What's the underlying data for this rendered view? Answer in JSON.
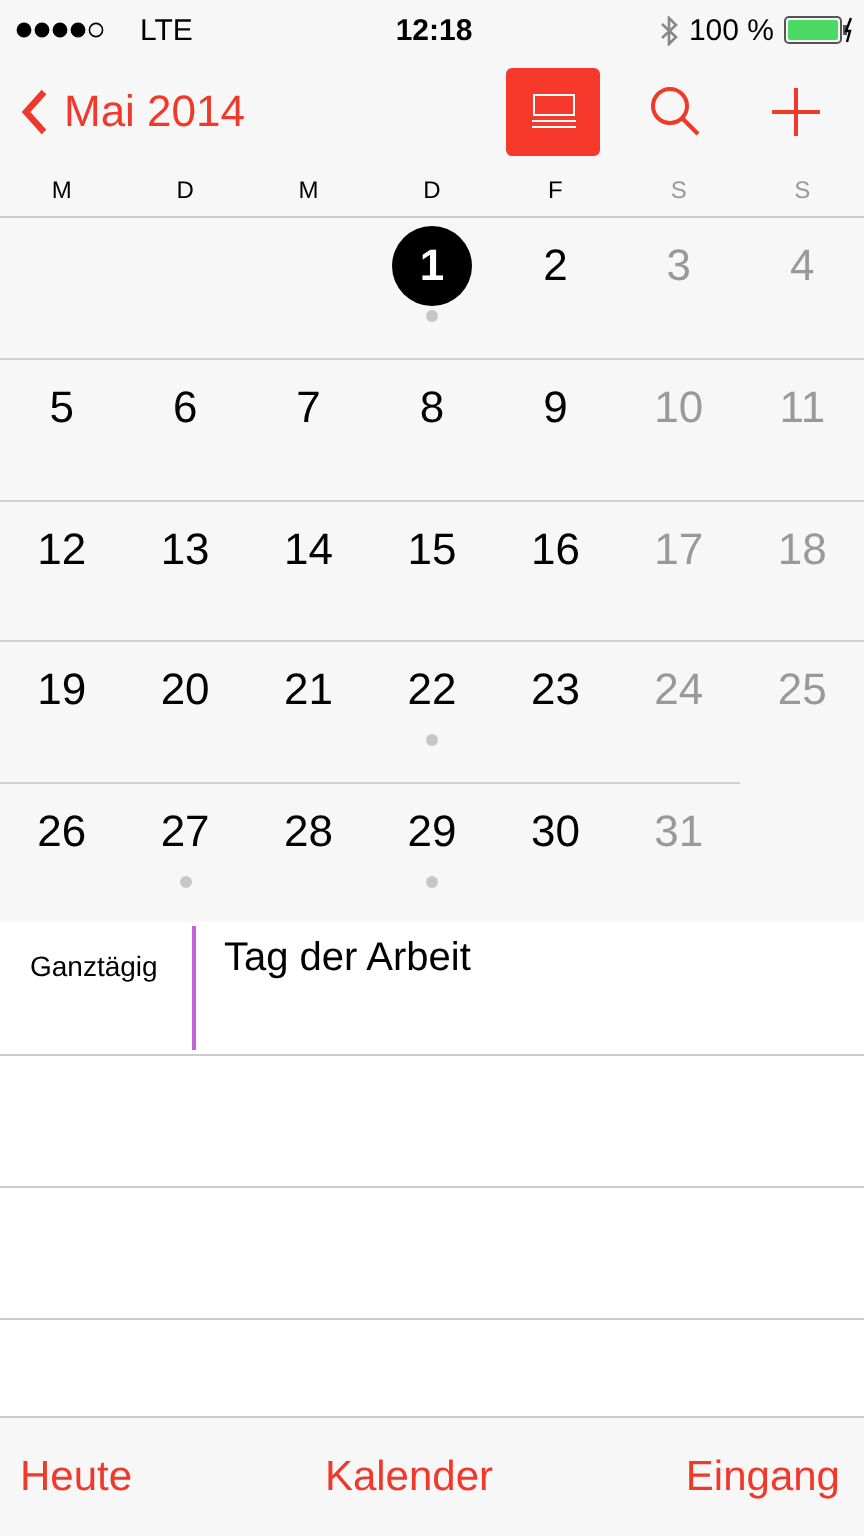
{
  "status_bar": {
    "carrier": "LTE",
    "time": "12:18",
    "battery": "100 %"
  },
  "nav": {
    "back_label": "Mai 2014",
    "list_view_selected": true
  },
  "weekdays": [
    {
      "label": "M",
      "weekend": false
    },
    {
      "label": "D",
      "weekend": false
    },
    {
      "label": "M",
      "weekend": false
    },
    {
      "label": "D",
      "weekend": false
    },
    {
      "label": "F",
      "weekend": false
    },
    {
      "label": "S",
      "weekend": true
    },
    {
      "label": "S",
      "weekend": true
    }
  ],
  "weeks": [
    [
      {
        "kind": "blank"
      },
      {
        "kind": "blank"
      },
      {
        "kind": "blank"
      },
      {
        "kind": "day",
        "label": "1",
        "selected": true,
        "has_event": true,
        "weekend": false
      },
      {
        "kind": "day",
        "label": "2",
        "selected": false,
        "has_event": false,
        "weekend": false
      },
      {
        "kind": "day",
        "label": "3",
        "selected": false,
        "has_event": false,
        "weekend": true
      },
      {
        "kind": "day",
        "label": "4",
        "selected": false,
        "has_event": false,
        "weekend": true
      }
    ],
    [
      {
        "kind": "day",
        "label": "5",
        "selected": false,
        "has_event": false,
        "weekend": false
      },
      {
        "kind": "day",
        "label": "6",
        "selected": false,
        "has_event": false,
        "weekend": false
      },
      {
        "kind": "day",
        "label": "7",
        "selected": false,
        "has_event": false,
        "weekend": false
      },
      {
        "kind": "day",
        "label": "8",
        "selected": false,
        "has_event": false,
        "weekend": false
      },
      {
        "kind": "day",
        "label": "9",
        "selected": false,
        "has_event": false,
        "weekend": false
      },
      {
        "kind": "day",
        "label": "10",
        "selected": false,
        "has_event": false,
        "weekend": true
      },
      {
        "kind": "day",
        "label": "11",
        "selected": false,
        "has_event": false,
        "weekend": true
      }
    ],
    [
      {
        "kind": "day",
        "label": "12",
        "selected": false,
        "has_event": false,
        "weekend": false
      },
      {
        "kind": "day",
        "label": "13",
        "selected": false,
        "has_event": false,
        "weekend": false
      },
      {
        "kind": "day",
        "label": "14",
        "selected": false,
        "has_event": false,
        "weekend": false
      },
      {
        "kind": "day",
        "label": "15",
        "selected": false,
        "has_event": false,
        "weekend": false
      },
      {
        "kind": "day",
        "label": "16",
        "selected": false,
        "has_event": false,
        "weekend": false
      },
      {
        "kind": "day",
        "label": "17",
        "selected": false,
        "has_event": false,
        "weekend": true
      },
      {
        "kind": "day",
        "label": "18",
        "selected": false,
        "has_event": false,
        "weekend": true
      }
    ],
    [
      {
        "kind": "day",
        "label": "19",
        "selected": false,
        "has_event": false,
        "weekend": false
      },
      {
        "kind": "day",
        "label": "20",
        "selected": false,
        "has_event": false,
        "weekend": false
      },
      {
        "kind": "day",
        "label": "21",
        "selected": false,
        "has_event": false,
        "weekend": false
      },
      {
        "kind": "day",
        "label": "22",
        "selected": false,
        "has_event": true,
        "weekend": false
      },
      {
        "kind": "day",
        "label": "23",
        "selected": false,
        "has_event": false,
        "weekend": false
      },
      {
        "kind": "day",
        "label": "24",
        "selected": false,
        "has_event": false,
        "weekend": true
      },
      {
        "kind": "day",
        "label": "25",
        "selected": false,
        "has_event": false,
        "weekend": true
      }
    ],
    [
      {
        "kind": "day",
        "label": "26",
        "selected": false,
        "has_event": false,
        "weekend": false
      },
      {
        "kind": "day",
        "label": "27",
        "selected": false,
        "has_event": true,
        "weekend": false
      },
      {
        "kind": "day",
        "label": "28",
        "selected": false,
        "has_event": false,
        "weekend": false
      },
      {
        "kind": "day",
        "label": "29",
        "selected": false,
        "has_event": true,
        "weekend": false
      },
      {
        "kind": "day",
        "label": "30",
        "selected": false,
        "has_event": false,
        "weekend": false
      },
      {
        "kind": "day",
        "label": "31",
        "selected": false,
        "has_event": false,
        "weekend": true
      },
      {
        "kind": "blank"
      }
    ]
  ],
  "all_day": {
    "label": "Ganztägig",
    "events": [
      {
        "title": "Tag der Arbeit",
        "color": "#c165d6"
      }
    ]
  },
  "tab_bar": [
    "Heute",
    "Kalender",
    "Eingang"
  ]
}
